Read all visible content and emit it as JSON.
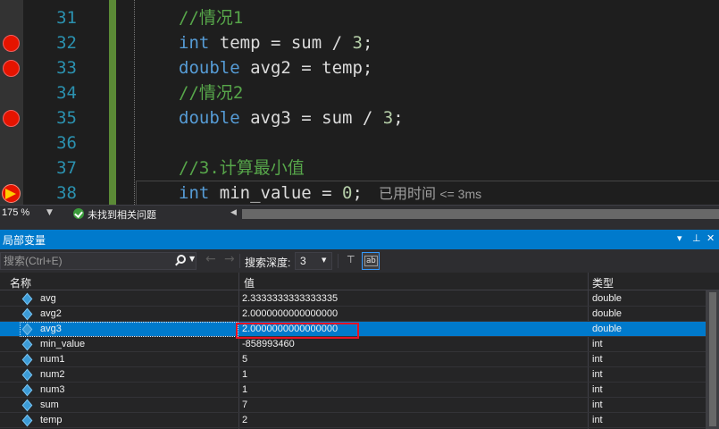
{
  "editor": {
    "lines": [
      {
        "num": "31",
        "breakpoint": false,
        "parts": [
          {
            "t": "//情况1",
            "c": "cm"
          }
        ]
      },
      {
        "num": "32",
        "breakpoint": true,
        "parts": [
          {
            "t": "int",
            "c": "kw"
          },
          {
            "t": " temp = sum / ",
            "c": ""
          },
          {
            "t": "3",
            "c": "num"
          },
          {
            "t": ";",
            "c": ""
          }
        ]
      },
      {
        "num": "33",
        "breakpoint": true,
        "parts": [
          {
            "t": "double",
            "c": "kw"
          },
          {
            "t": " avg2 = temp;",
            "c": ""
          }
        ]
      },
      {
        "num": "34",
        "breakpoint": false,
        "parts": [
          {
            "t": "//情况2",
            "c": "cm"
          }
        ]
      },
      {
        "num": "35",
        "breakpoint": true,
        "parts": [
          {
            "t": "double",
            "c": "kw"
          },
          {
            "t": " avg3 = sum / ",
            "c": ""
          },
          {
            "t": "3",
            "c": "num"
          },
          {
            "t": ";",
            "c": ""
          }
        ]
      },
      {
        "num": "36",
        "breakpoint": false,
        "parts": []
      },
      {
        "num": "37",
        "breakpoint": false,
        "parts": [
          {
            "t": "//3.计算最小值",
            "c": "cm"
          }
        ]
      },
      {
        "num": "38",
        "breakpoint": false,
        "current": true,
        "parts": [
          {
            "t": "int",
            "c": "kw"
          },
          {
            "t": " min_value = ",
            "c": ""
          },
          {
            "t": "0",
            "c": "num"
          },
          {
            "t": ";",
            "c": ""
          }
        ]
      }
    ],
    "elapsed_hint": "已用时间",
    "elapsed_value": "<= 3ms"
  },
  "status": {
    "zoom": "175 %",
    "issues": "未找到相关问题"
  },
  "locals": {
    "title": "局部变量",
    "window_buttons": {
      "dropdown": "▾",
      "pin": "⊥",
      "close": "✕"
    },
    "search_placeholder": "搜索(Ctrl+E)",
    "depth_label": "搜索深度:",
    "depth_value": "3",
    "columns": {
      "name": "名称",
      "value": "值",
      "type": "类型"
    },
    "rows": [
      {
        "name": "avg",
        "value": "2.3333333333333335",
        "type": "double",
        "selected": false
      },
      {
        "name": "avg2",
        "value": "2.0000000000000000",
        "type": "double",
        "selected": false
      },
      {
        "name": "avg3",
        "value": "2.0000000000000000",
        "type": "double",
        "selected": true
      },
      {
        "name": "min_value",
        "value": "-858993460",
        "type": "int",
        "selected": false
      },
      {
        "name": "num1",
        "value": "5",
        "type": "int",
        "selected": false
      },
      {
        "name": "num2",
        "value": "1",
        "type": "int",
        "selected": false
      },
      {
        "name": "num3",
        "value": "1",
        "type": "int",
        "selected": false
      },
      {
        "name": "sum",
        "value": "7",
        "type": "int",
        "selected": false
      },
      {
        "name": "temp",
        "value": "2",
        "type": "int",
        "selected": false
      }
    ]
  },
  "colors": {
    "accent": "#007acc",
    "breakpoint": "#e51400",
    "highlight": "#e81123"
  }
}
